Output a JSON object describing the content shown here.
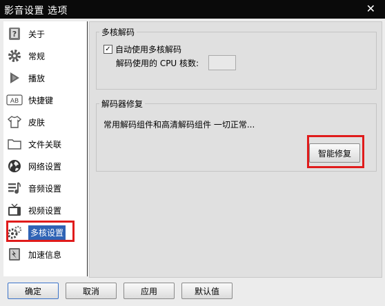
{
  "window": {
    "title": "影音设置 选项",
    "close_glyph": "✕"
  },
  "sidebar": {
    "items": [
      {
        "label": "关于",
        "icon": "info-icon"
      },
      {
        "label": "常规",
        "icon": "gear-icon"
      },
      {
        "label": "播放",
        "icon": "play-icon"
      },
      {
        "label": "快捷键",
        "icon": "keyboard-icon"
      },
      {
        "label": "皮肤",
        "icon": "shirt-icon"
      },
      {
        "label": "文件关联",
        "icon": "folder-icon"
      },
      {
        "label": "网络设置",
        "icon": "globe-icon"
      },
      {
        "label": "音频设置",
        "icon": "audio-icon"
      },
      {
        "label": "视频设置",
        "icon": "tv-icon"
      },
      {
        "label": "多核设置",
        "icon": "multicore-icon"
      },
      {
        "label": "加速信息",
        "icon": "speed-icon"
      }
    ],
    "active_index": 9
  },
  "multicore": {
    "group_title": "多核解码",
    "auto_checkbox_label": "自动使用多核解码",
    "auto_checked": true,
    "cpu_label": "解码使用的 CPU 核数:",
    "cpu_value": ""
  },
  "repair": {
    "group_title": "解码器修复",
    "status_text": "常用解码组件和高清解码组件 一切正常...",
    "button_label": "智能修复"
  },
  "buttons": {
    "ok": "确定",
    "cancel": "取消",
    "apply": "应用",
    "default": "默认值"
  },
  "colors": {
    "highlight": "#e01b1b",
    "active_bg": "#2f63b5"
  }
}
